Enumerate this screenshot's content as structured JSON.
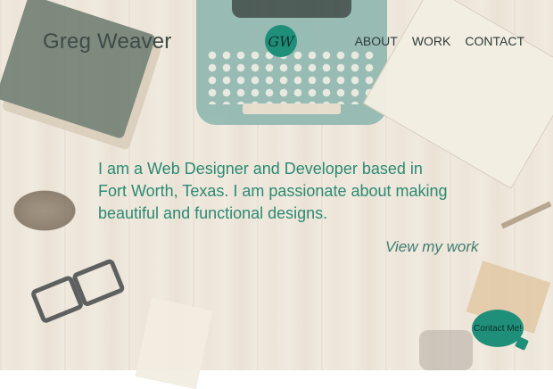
{
  "header": {
    "name": "Greg Weaver",
    "logo_text": "GW",
    "nav": [
      "ABOUT",
      "WORK",
      "CONTACT"
    ]
  },
  "hero": {
    "line1": "I am a Web Designer and Developer based in",
    "line2": "Fort Worth, Texas. I am passionate about making",
    "line3": "beautiful and functional designs.",
    "cta": "View my work"
  },
  "contact_bubble": {
    "label": "Contact Me!"
  },
  "colors": {
    "accent": "#1f8f7a",
    "heading_text": "#2b8a73"
  }
}
